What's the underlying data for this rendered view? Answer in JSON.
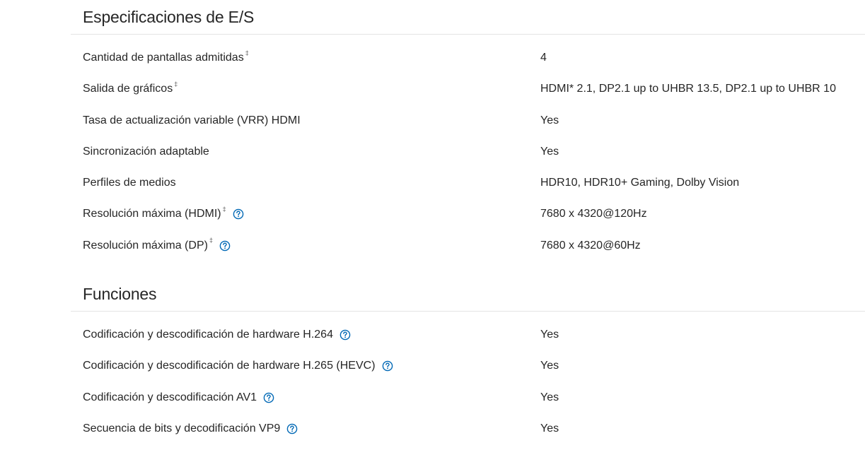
{
  "sections": [
    {
      "title": "Especificaciones de E/S",
      "rows": [
        {
          "label": "Cantidad de pantallas admitidas",
          "dagger": "‡",
          "help": false,
          "value": "4"
        },
        {
          "label": "Salida de gráficos",
          "dagger": "‡",
          "help": false,
          "value": "HDMI* 2.1, DP2.1 up to UHBR 13.5, DP2.1 up to UHBR 10"
        },
        {
          "label": "Tasa de actualización variable (VRR) HDMI",
          "dagger": "",
          "help": false,
          "value": "Yes"
        },
        {
          "label": "Sincronización adaptable",
          "dagger": "",
          "help": false,
          "value": "Yes"
        },
        {
          "label": "Perfiles de medios",
          "dagger": "",
          "help": false,
          "value": "HDR10, HDR10+ Gaming, Dolby Vision"
        },
        {
          "label": "Resolución máxima (HDMI)",
          "dagger": "‡",
          "help": true,
          "value": "7680 x 4320@120Hz"
        },
        {
          "label": "Resolución máxima (DP)",
          "dagger": "‡",
          "help": true,
          "value": "7680 x 4320@60Hz"
        }
      ]
    },
    {
      "title": "Funciones",
      "rows": [
        {
          "label": "Codificación y descodificación de hardware H.264",
          "dagger": "",
          "help": true,
          "value": "Yes"
        },
        {
          "label": "Codificación y descodificación de hardware H.265 (HEVC)",
          "dagger": "",
          "help": true,
          "value": "Yes"
        },
        {
          "label": "Codificación y descodificación AV1",
          "dagger": "",
          "help": true,
          "value": "Yes"
        },
        {
          "label": "Secuencia de bits y decodificación VP9",
          "dagger": "",
          "help": true,
          "value": "Yes"
        }
      ]
    }
  ],
  "colors": {
    "text": "#262626",
    "divider": "#e4e4e4",
    "help_icon": "#0068b5"
  },
  "icons": {
    "help": "question-circle-icon"
  }
}
